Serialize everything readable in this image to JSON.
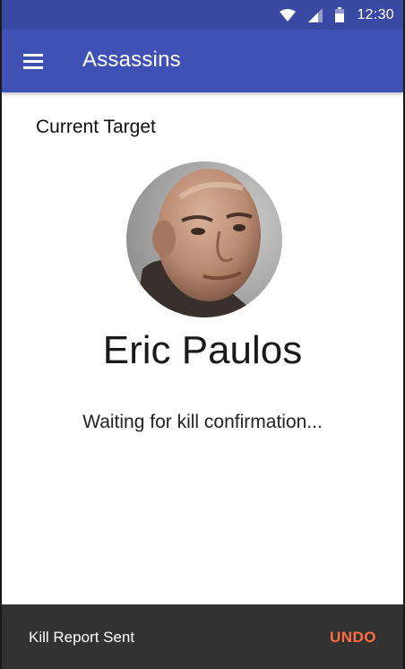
{
  "status_bar": {
    "time": "12:30",
    "icons": [
      "wifi-icon",
      "cell-signal-icon",
      "battery-icon"
    ]
  },
  "app_bar": {
    "menu_icon": "hamburger-menu-icon",
    "title": "Assassins"
  },
  "main": {
    "section_label": "Current Target",
    "target": {
      "name": "Eric Paulos",
      "avatar": "avatar-photo"
    },
    "status_text": "Waiting for kill confirmation..."
  },
  "snackbar": {
    "message": "Kill Report Sent",
    "action_label": "UNDO"
  },
  "colors": {
    "status_bar": "#3949a3",
    "app_bar": "#3f51b5",
    "snackbar_bg": "#323232",
    "snackbar_action": "#ff6e40"
  }
}
